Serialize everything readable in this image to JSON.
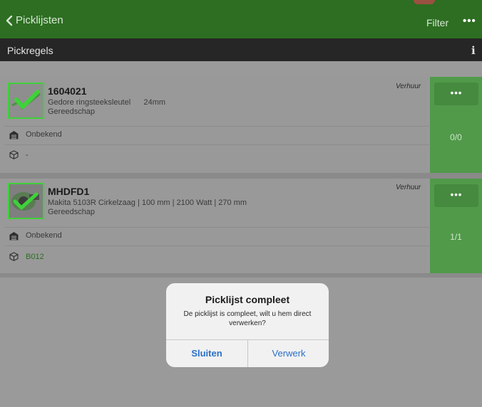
{
  "navbar": {
    "back_label": "Picklijsten",
    "filter_label": "Filter",
    "more_label": "•••"
  },
  "subbar": {
    "title": "Pickregels",
    "info_label": "i"
  },
  "items": [
    {
      "code": "1604021",
      "description": "Gedore ringsteeksleutel      24mm",
      "category": "Gereedschap",
      "type": "Verhuur",
      "warehouse": "Onbekend",
      "location": "-",
      "count": "0/0",
      "more_label": "•••"
    },
    {
      "code": "MHDFD1",
      "description": "Makita 5103R Cirkelzaag | 100 mm | 2100 Watt | 270 mm",
      "category": "Gereedschap",
      "type": "Verhuur",
      "warehouse": "Onbekend",
      "location": "B012",
      "count": "1/1",
      "more_label": "•••"
    }
  ],
  "dialog": {
    "title": "Picklijst compleet",
    "message": "De picklijst is compleet, wilt u hem direct verwerken?",
    "cancel_label": "Sluiten",
    "confirm_label": "Verwerk"
  },
  "colors": {
    "navbar": "#2d6e22",
    "subbar": "#262626",
    "side_panel": "#519a4a",
    "check": "#3fd13a",
    "dialog_button": "#2b6fc7"
  }
}
